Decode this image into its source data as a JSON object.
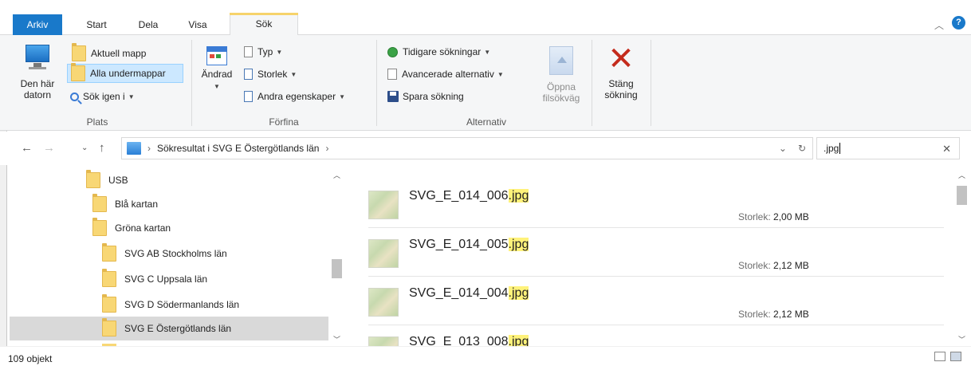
{
  "tabs": {
    "file": "Arkiv",
    "start": "Start",
    "share": "Dela",
    "view": "Visa",
    "search": "Sök"
  },
  "ribbon": {
    "location": {
      "this_pc_line1": "Den här",
      "this_pc_line2": "datorn",
      "current_folder": "Aktuell mapp",
      "all_subfolders": "Alla undermappar",
      "search_again": "Sök igen i",
      "group_label": "Plats"
    },
    "refine": {
      "date_modified": "Ändrad",
      "type": "Typ",
      "size": "Storlek",
      "other_properties": "Andra egenskaper",
      "group_label": "Förfina"
    },
    "options": {
      "recent_searches": "Tidigare sökningar",
      "advanced_options": "Avancerade alternativ",
      "save_search": "Spara sökning",
      "open_location_line1": "Öppna",
      "open_location_line2": "filsökväg",
      "group_label": "Alternativ"
    },
    "close": {
      "line1": "Stäng",
      "line2": "sökning"
    }
  },
  "address": {
    "path": "Sökresultat i SVG E Östergötlands län",
    "search_value": ".jpg"
  },
  "tree": {
    "items": [
      {
        "label": "USB"
      },
      {
        "label": "Blå kartan"
      },
      {
        "label": "Gröna kartan"
      },
      {
        "label": "SVG AB Stockholms län"
      },
      {
        "label": "SVG C Uppsala län"
      },
      {
        "label": "SVG D Södermanlands län"
      },
      {
        "label": "SVG E Östergötlands län"
      }
    ]
  },
  "results": {
    "size_key": "Storlek:",
    "highlight": ".jpg",
    "items": [
      {
        "base": "SVG_E_014_006",
        "size": "2,00 MB"
      },
      {
        "base": "SVG_E_014_005",
        "size": "2,12 MB"
      },
      {
        "base": "SVG_E_014_004",
        "size": "2,12 MB"
      },
      {
        "base": "SVG_E_013_008",
        "size": ""
      }
    ]
  },
  "status": {
    "count": "109 objekt"
  },
  "colors": {
    "accent": "#1979ca",
    "highlight": "#fff27a",
    "selected_tree": "#d9d9d9",
    "close_x": "#c42b1c"
  }
}
